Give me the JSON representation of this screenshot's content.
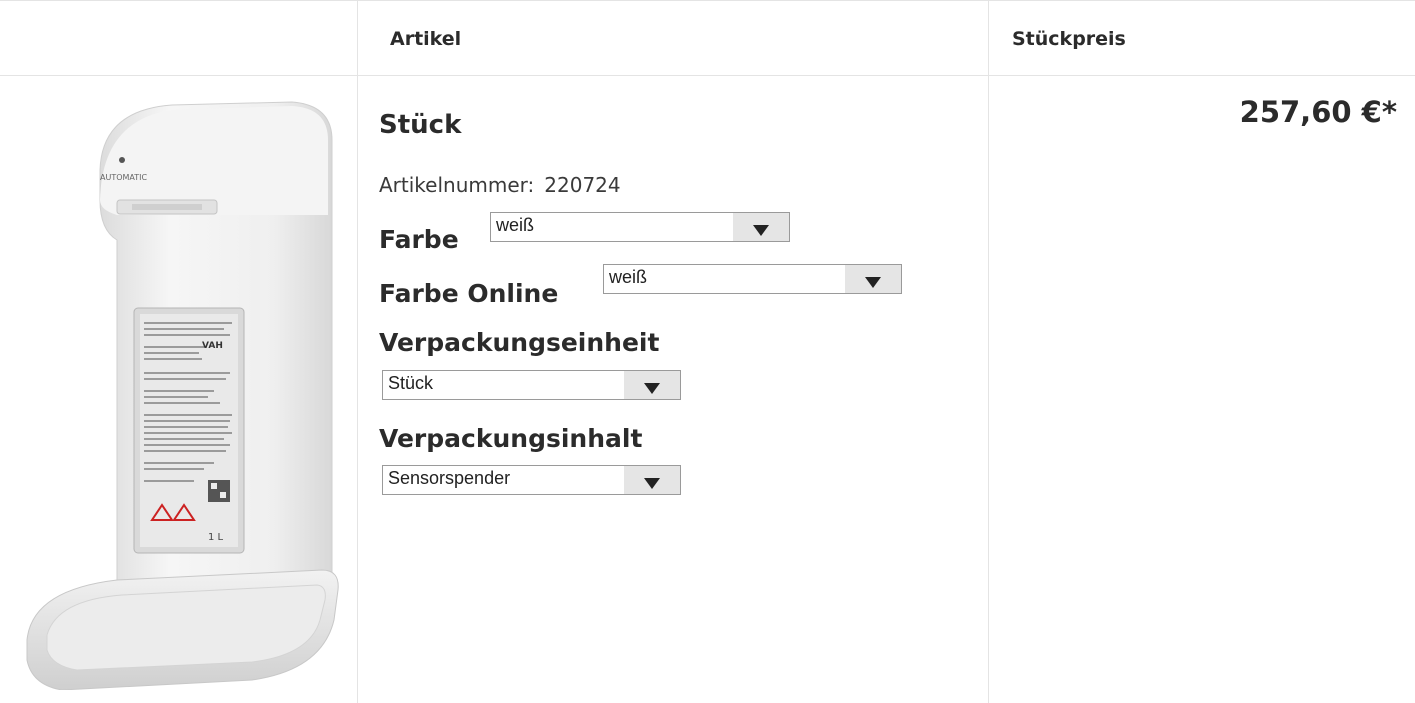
{
  "table": {
    "headers": {
      "image": "",
      "article": "Artikel",
      "unit_price": "Stückpreis"
    }
  },
  "product": {
    "image_icon": "soap-dispenser-image",
    "dispenser_text": "AUTOMATIC",
    "volume_text": "1 L",
    "title": "Stück",
    "article_number_label": "Artikelnummer:",
    "article_number": "220724",
    "price": "257,60 €*"
  },
  "options": {
    "farbe": {
      "label": "Farbe",
      "value": "weiß"
    },
    "farbe_online": {
      "label": "Farbe Online",
      "value": "weiß"
    },
    "verpackungseinheit": {
      "label": "Verpackungseinheit",
      "value": "Stück"
    },
    "verpackungsinhalt": {
      "label": "Verpackungsinhalt",
      "value": "Sensorspender"
    }
  },
  "colors": {
    "border": "#e4e4e4",
    "text": "#2b2b2b",
    "select_button": "#e5e5e5"
  }
}
